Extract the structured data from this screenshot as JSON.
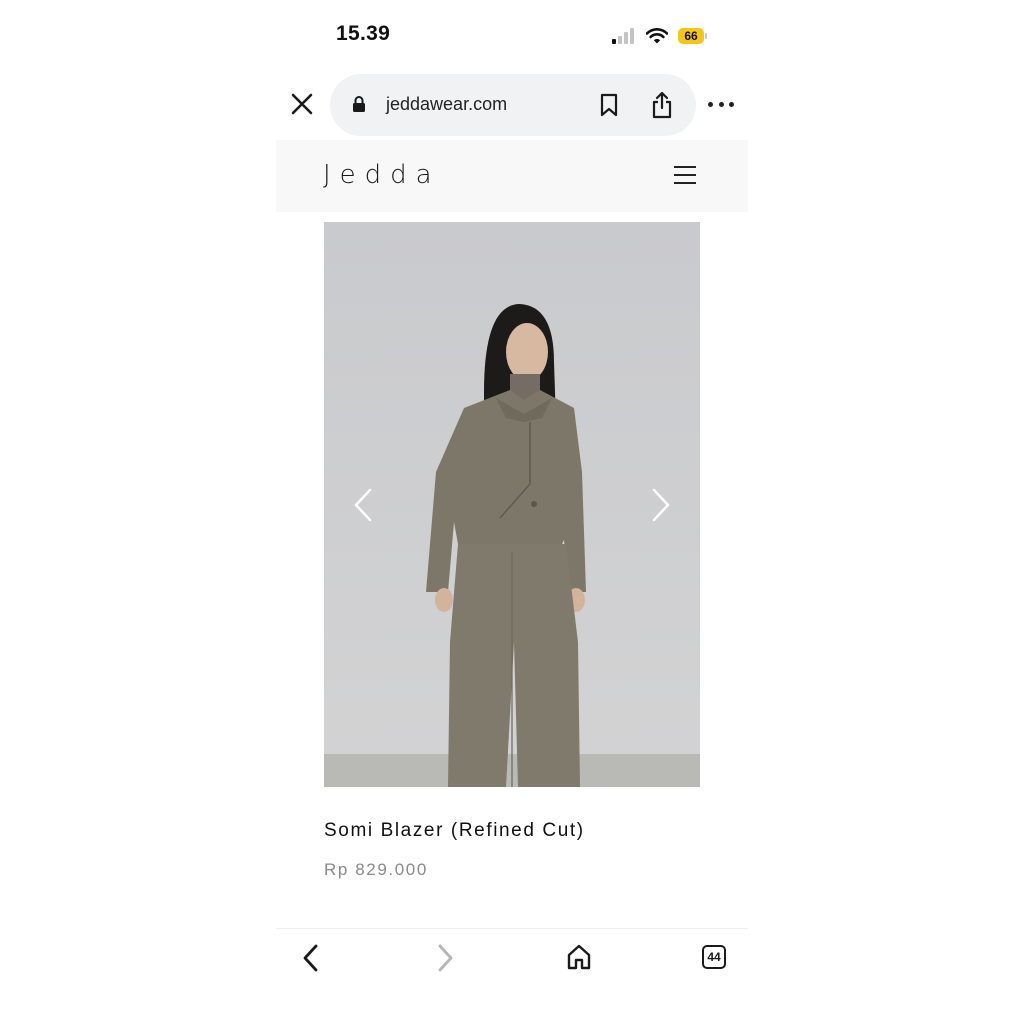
{
  "status_bar": {
    "time": "15.39",
    "battery_level": "66",
    "battery_color": "#f5c518"
  },
  "browser": {
    "url": "jeddawear.com",
    "icons": [
      "close-icon",
      "lock-icon",
      "bookmark-icon",
      "share-icon",
      "more-icon"
    ]
  },
  "site": {
    "brand": "Jedda",
    "menu_icon": "hamburger-icon"
  },
  "product": {
    "name": "Somi Blazer (Refined Cut)",
    "price": "Rp 829.000",
    "image_alt_colors": {
      "background": "#cfd0d3",
      "garment": "#7d7769"
    },
    "carousel_icons": [
      "chevron-left-icon",
      "chevron-right-icon"
    ]
  },
  "toolbar": {
    "tab_count": "44",
    "icons": [
      "back-arrow-icon",
      "forward-arrow-icon",
      "home-icon",
      "tabs-icon"
    ]
  }
}
